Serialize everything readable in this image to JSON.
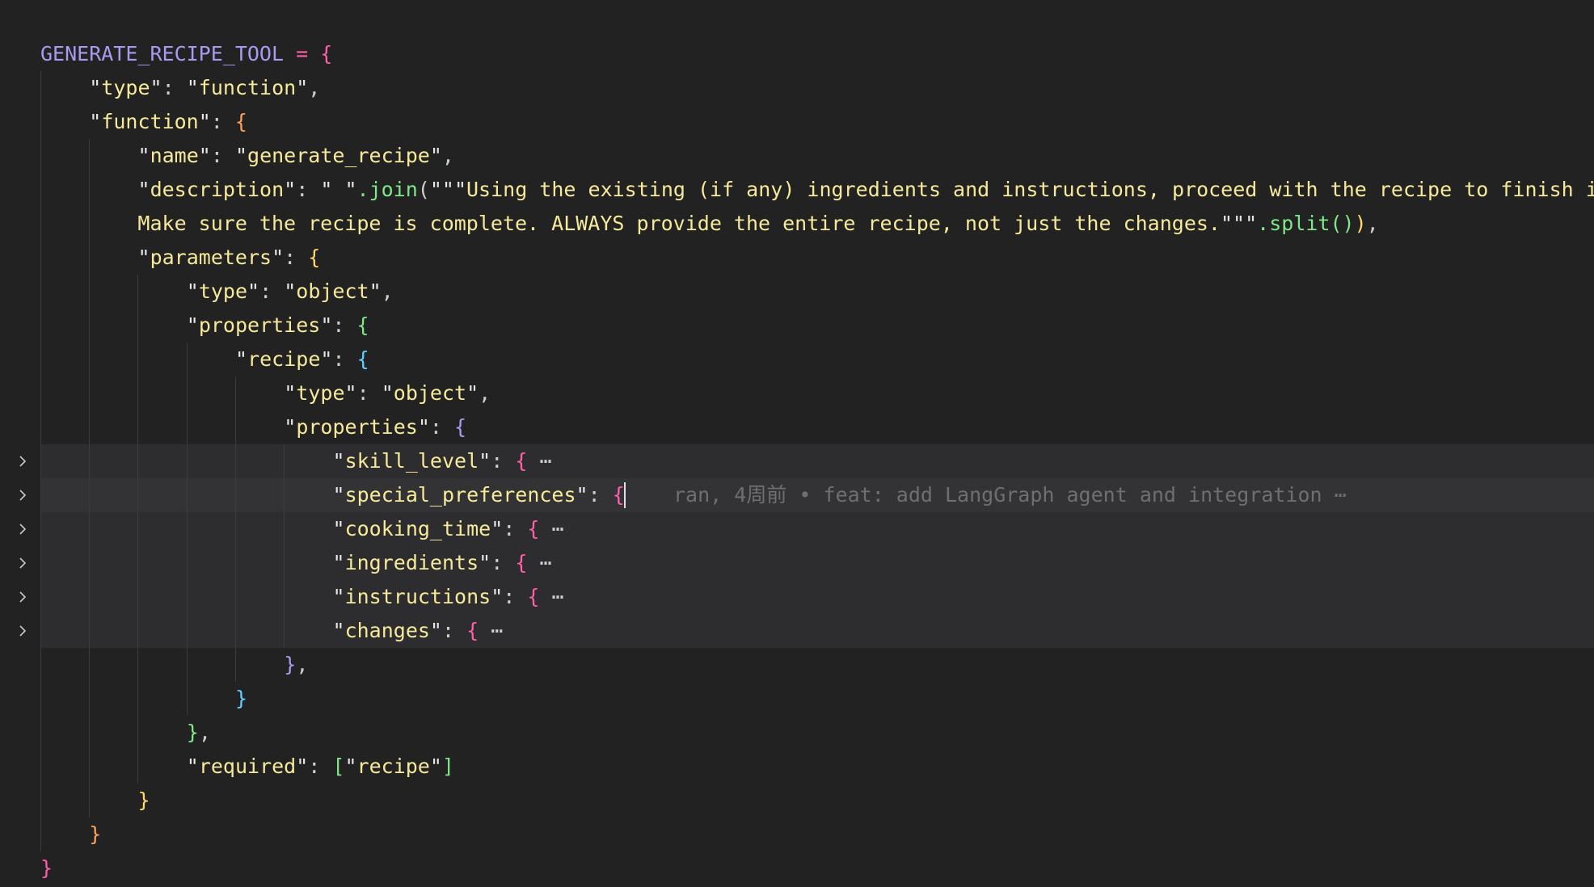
{
  "editor": {
    "blame": {
      "author": "ran",
      "time": "4周前",
      "separator": "•",
      "message": "feat: add LangGraph agent and integration",
      "more": "⋯"
    },
    "folded_ellipsis": "⋯",
    "lines": [
      {
        "text": "GENERATE_RECIPE_TOOL = {"
      },
      {
        "text": "    \"type\": \"function\","
      },
      {
        "text": "    \"function\": {"
      },
      {
        "text": "        \"name\": \"generate_recipe\","
      },
      {
        "text": "        \"description\": \" \".join(\"\"\"Using the existing (if any) ingredients and instructions, proceed with the recipe to finish it."
      },
      {
        "text": "        Make sure the recipe is complete. ALWAYS provide the entire recipe, not just the changes.\"\"\".split()),"
      },
      {
        "text": "        \"parameters\": {"
      },
      {
        "text": "            \"type\": \"object\","
      },
      {
        "text": "            \"properties\": {"
      },
      {
        "text": "                \"recipe\": {"
      },
      {
        "text": "                    \"type\": \"object\","
      },
      {
        "text": "                    \"properties\": {"
      },
      {
        "text": "                        \"skill_level\": {",
        "folded": true
      },
      {
        "text": "                        \"special_preferences\": {",
        "folded": true,
        "current": true
      },
      {
        "text": "                        \"cooking_time\": {",
        "folded": true
      },
      {
        "text": "                        \"ingredients\": {",
        "folded": true
      },
      {
        "text": "                        \"instructions\": {",
        "folded": true
      },
      {
        "text": "                        \"changes\": {",
        "folded": true
      },
      {
        "text": "                    },"
      },
      {
        "text": "                }"
      },
      {
        "text": "            },"
      },
      {
        "text": "            \"required\": [\"recipe\"]"
      },
      {
        "text": "        }"
      },
      {
        "text": "    }"
      },
      {
        "text": "}"
      }
    ]
  },
  "colors": {
    "background": "#222222",
    "fold_highlight": "#2d2d30",
    "variable": "#a79bf0",
    "operator": "#ff5fa8",
    "string": "#f6e99a",
    "function_call": "#7ee787",
    "blame": "#6f6f6f",
    "bracket_depth": [
      "#ff5fa8",
      "#ffa155",
      "#ffd866",
      "#7ee787",
      "#5fd0ff",
      "#a79bf0"
    ]
  },
  "icons": {
    "fold": "chevron-right-icon"
  }
}
